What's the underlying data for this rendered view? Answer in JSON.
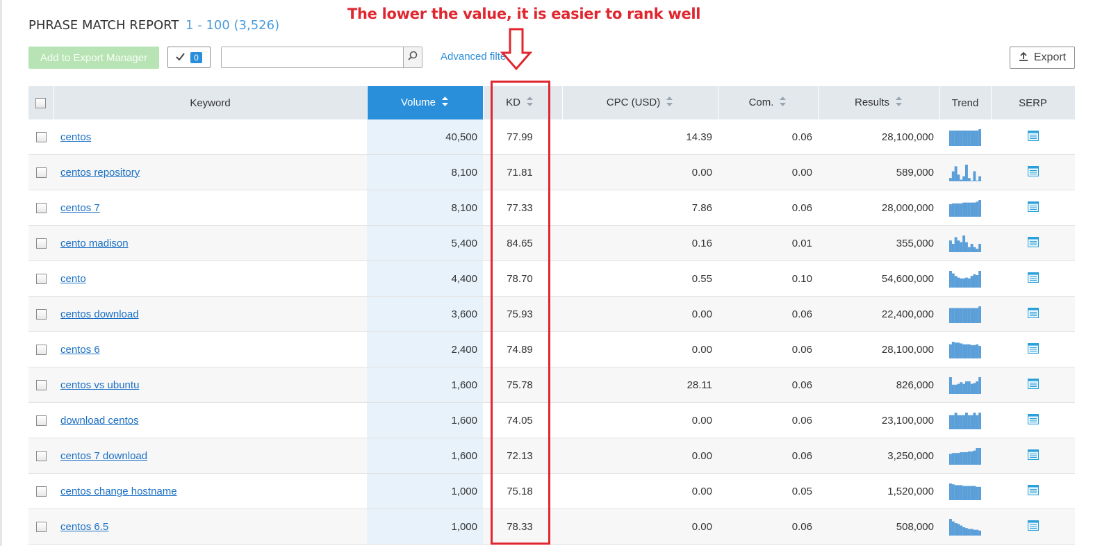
{
  "report": {
    "title": "PHRASE MATCH REPORT",
    "range": "1 - 100 (3,526)"
  },
  "annotation": {
    "text": "The lower the value, it is easier to rank well"
  },
  "toolbar": {
    "export_manager_label": "Add to Export Manager",
    "selected_count": "0",
    "search_value": "",
    "advanced_filters_label": "Advanced filters",
    "export_label": "Export"
  },
  "columns": [
    "Keyword",
    "Volume",
    "KD",
    "CPC (USD)",
    "Com.",
    "Results",
    "Trend",
    "SERP"
  ],
  "rows": [
    {
      "keyword": "centos",
      "volume": "40,500",
      "kd": "77.99",
      "cpc": "14.39",
      "com": "0.06",
      "results": "28,100,000",
      "trend": [
        0.92,
        0.92,
        0.92,
        0.92,
        0.92,
        0.92,
        0.92,
        0.92,
        0.92,
        0.92,
        0.92,
        1.0
      ]
    },
    {
      "keyword": "centos repository",
      "volume": "8,100",
      "kd": "71.81",
      "cpc": "0.00",
      "com": "0.00",
      "results": "589,000",
      "trend": [
        0.2,
        0.6,
        0.9,
        0.4,
        0.1,
        0.3,
        1.0,
        0.2,
        0.0,
        0.6,
        0.0,
        0.3
      ]
    },
    {
      "keyword": "centos 7",
      "volume": "8,100",
      "kd": "77.33",
      "cpc": "7.86",
      "com": "0.06",
      "results": "28,000,000",
      "trend": [
        0.75,
        0.8,
        0.8,
        0.8,
        0.8,
        0.85,
        0.85,
        0.85,
        0.85,
        0.85,
        0.9,
        1.0
      ]
    },
    {
      "keyword": "cento madison",
      "volume": "5,400",
      "kd": "84.65",
      "cpc": "0.16",
      "com": "0.01",
      "results": "355,000",
      "trend": [
        0.7,
        0.5,
        0.9,
        0.7,
        0.6,
        1.0,
        0.6,
        0.3,
        0.5,
        0.3,
        0.2,
        0.5
      ]
    },
    {
      "keyword": "cento",
      "volume": "4,400",
      "kd": "78.70",
      "cpc": "0.55",
      "com": "0.10",
      "results": "54,600,000",
      "trend": [
        1.0,
        0.85,
        0.7,
        0.6,
        0.55,
        0.55,
        0.6,
        0.55,
        0.7,
        0.8,
        0.75,
        1.0
      ]
    },
    {
      "keyword": "centos download",
      "volume": "3,600",
      "kd": "75.93",
      "cpc": "0.00",
      "com": "0.06",
      "results": "22,400,000",
      "trend": [
        0.9,
        0.9,
        0.9,
        0.9,
        0.9,
        0.9,
        0.9,
        0.9,
        0.9,
        0.9,
        0.9,
        1.0
      ]
    },
    {
      "keyword": "centos 6",
      "volume": "2,400",
      "kd": "74.89",
      "cpc": "0.00",
      "com": "0.06",
      "results": "28,100,000",
      "trend": [
        0.85,
        1.0,
        0.95,
        0.95,
        0.9,
        0.85,
        0.85,
        0.85,
        0.8,
        0.8,
        0.85,
        0.75
      ]
    },
    {
      "keyword": "centos vs ubuntu",
      "volume": "1,600",
      "kd": "75.78",
      "cpc": "28.11",
      "com": "0.06",
      "results": "826,000",
      "trend": [
        1.0,
        0.55,
        0.55,
        0.6,
        0.7,
        0.6,
        0.75,
        0.75,
        0.6,
        0.65,
        0.75,
        1.0
      ]
    },
    {
      "keyword": "download centos",
      "volume": "1,600",
      "kd": "74.05",
      "cpc": "0.00",
      "com": "0.06",
      "results": "23,100,000",
      "trend": [
        0.85,
        0.85,
        1.0,
        0.85,
        0.85,
        0.85,
        1.0,
        0.85,
        0.85,
        1.0,
        0.85,
        1.0
      ]
    },
    {
      "keyword": "centos 7 download",
      "volume": "1,600",
      "kd": "72.13",
      "cpc": "0.00",
      "com": "0.06",
      "results": "3,250,000",
      "trend": [
        0.65,
        0.7,
        0.7,
        0.7,
        0.75,
        0.75,
        0.75,
        0.8,
        0.8,
        0.85,
        1.0,
        1.0
      ]
    },
    {
      "keyword": "centos change hostname",
      "volume": "1,000",
      "kd": "75.18",
      "cpc": "0.00",
      "com": "0.05",
      "results": "1,520,000",
      "trend": [
        1.0,
        0.95,
        0.9,
        0.9,
        0.9,
        0.85,
        0.85,
        0.85,
        0.85,
        0.85,
        0.8,
        0.8
      ]
    },
    {
      "keyword": "centos 6.5",
      "volume": "1,000",
      "kd": "78.33",
      "cpc": "0.00",
      "com": "0.06",
      "results": "508,000",
      "trend": [
        1.0,
        0.85,
        0.75,
        0.7,
        0.6,
        0.5,
        0.45,
        0.4,
        0.4,
        0.35,
        0.35,
        0.3
      ]
    }
  ],
  "colors": {
    "accent": "#2a8fdb",
    "trend_bar": "#5b9fd9",
    "annotation": "#e0262f"
  }
}
